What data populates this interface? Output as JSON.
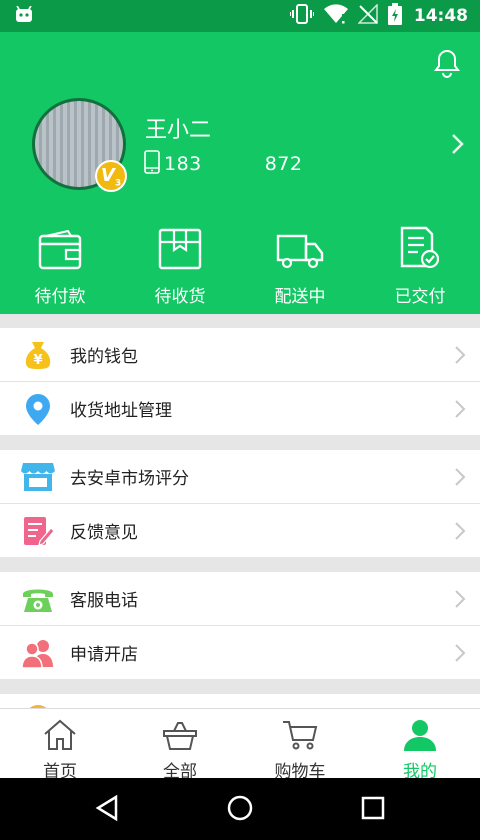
{
  "status_bar": {
    "time": "14:48"
  },
  "profile": {
    "name": "王小二",
    "phone": "183     872",
    "vip_level": "V",
    "vip_sub": "3"
  },
  "orders": [
    {
      "label": "待付款",
      "icon": "wallet-icon"
    },
    {
      "label": "待收货",
      "icon": "package-icon"
    },
    {
      "label": "配送中",
      "icon": "truck-icon"
    },
    {
      "label": "已交付",
      "icon": "delivered-doc-icon"
    }
  ],
  "menu_groups": [
    [
      {
        "label": "我的钱包",
        "icon": "money-bag-icon"
      },
      {
        "label": "收货地址管理",
        "icon": "location-pin-icon"
      }
    ],
    [
      {
        "label": "去安卓市场评分",
        "icon": "store-icon"
      },
      {
        "label": "反馈意见",
        "icon": "feedback-icon"
      }
    ],
    [
      {
        "label": "客服电话",
        "icon": "phone-icon"
      },
      {
        "label": "申请开店",
        "icon": "users-icon"
      }
    ]
  ],
  "tabs": [
    {
      "label": "首页",
      "icon": "home-icon"
    },
    {
      "label": "全部",
      "icon": "basket-icon"
    },
    {
      "label": "购物车",
      "icon": "cart-icon"
    },
    {
      "label": "我的",
      "icon": "person-icon",
      "active": true
    }
  ],
  "colors": {
    "primary": "#13c864",
    "status_bar": "#0b9a48",
    "vip_badge": "#f2b90f"
  }
}
